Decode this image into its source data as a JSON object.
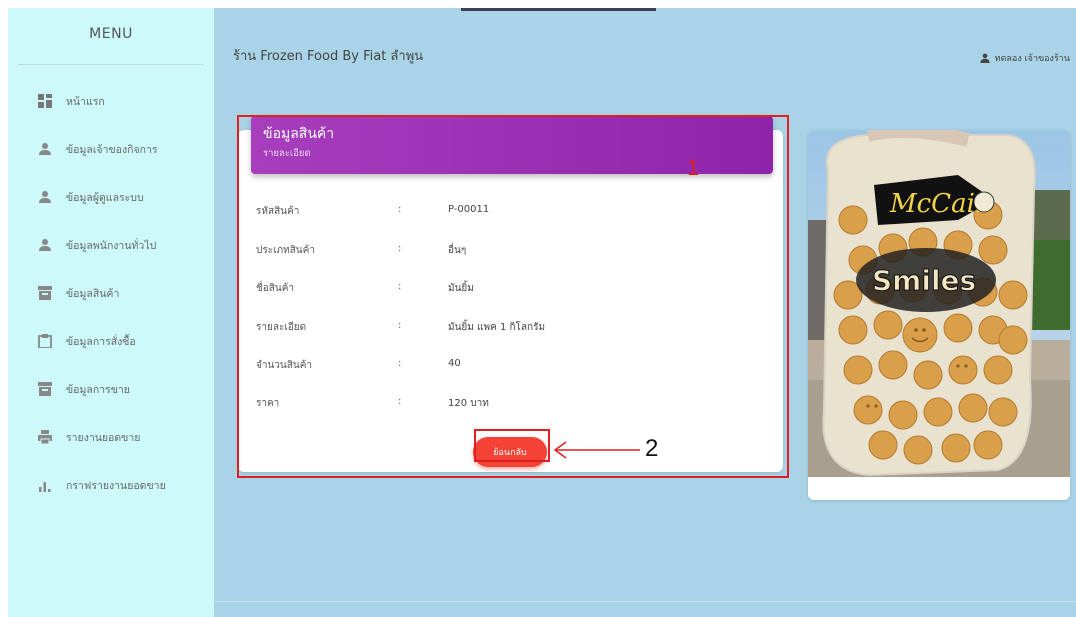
{
  "sidebar": {
    "title": "MENU",
    "items": [
      {
        "label": "หน้าแรก",
        "icon": "dashboard-icon"
      },
      {
        "label": "ข้อมูลเจ้าของกิจการ",
        "icon": "person-icon"
      },
      {
        "label": "ข้อมูลผู้ดูแลระบบ",
        "icon": "person-icon"
      },
      {
        "label": "ข้อมูลพนักงานทั่วไป",
        "icon": "person-icon"
      },
      {
        "label": "ข้อมูลสินค้า",
        "icon": "archive-icon"
      },
      {
        "label": "ข้อมูลการสั่งซื้อ",
        "icon": "clipboard-icon"
      },
      {
        "label": "ข้อมูลการขาย",
        "icon": "archive-icon"
      },
      {
        "label": "รายงานยอดขาย",
        "icon": "printer-icon"
      },
      {
        "label": "กราฟรายงานยอดขาย",
        "icon": "bar-chart-icon"
      }
    ]
  },
  "header": {
    "shop_title": "ร้าน Frozen Food By Fiat ลำพูน",
    "user_name": "ทดลอง เจ้าของร้าน"
  },
  "card": {
    "title": "ข้อมูลสินค้า",
    "subtitle": "รายละเอียด",
    "rows": [
      {
        "label": "รหัสสินค้า",
        "colon": ":",
        "value": "P-00011"
      },
      {
        "label": "ประเภทสินค้า",
        "colon": ":",
        "value": "อื่นๆ"
      },
      {
        "label": "ชื่อสินค้า",
        "colon": ":",
        "value": "มันยิ้ม"
      },
      {
        "label": "รายละเอียด",
        "colon": ":",
        "value": "มันยิ้ม แพค 1 กิโลกรัม"
      },
      {
        "label": "จำนวนสินค้า",
        "colon": ":",
        "value": "40"
      },
      {
        "label": "ราคา",
        "colon": ":",
        "value": "120 บาท"
      }
    ],
    "back_button": "ย้อนกลับ"
  },
  "annotations": {
    "label_1": "1",
    "label_2": "2"
  },
  "photo": {
    "brand_text": "McCain",
    "product_text": "Smiles"
  },
  "colors": {
    "background": "#a9d3e6",
    "sidebar": "#cdf9fb",
    "header_purple": "#9c27b0",
    "button_red": "#f44336",
    "annotation_red": "#e02020"
  }
}
